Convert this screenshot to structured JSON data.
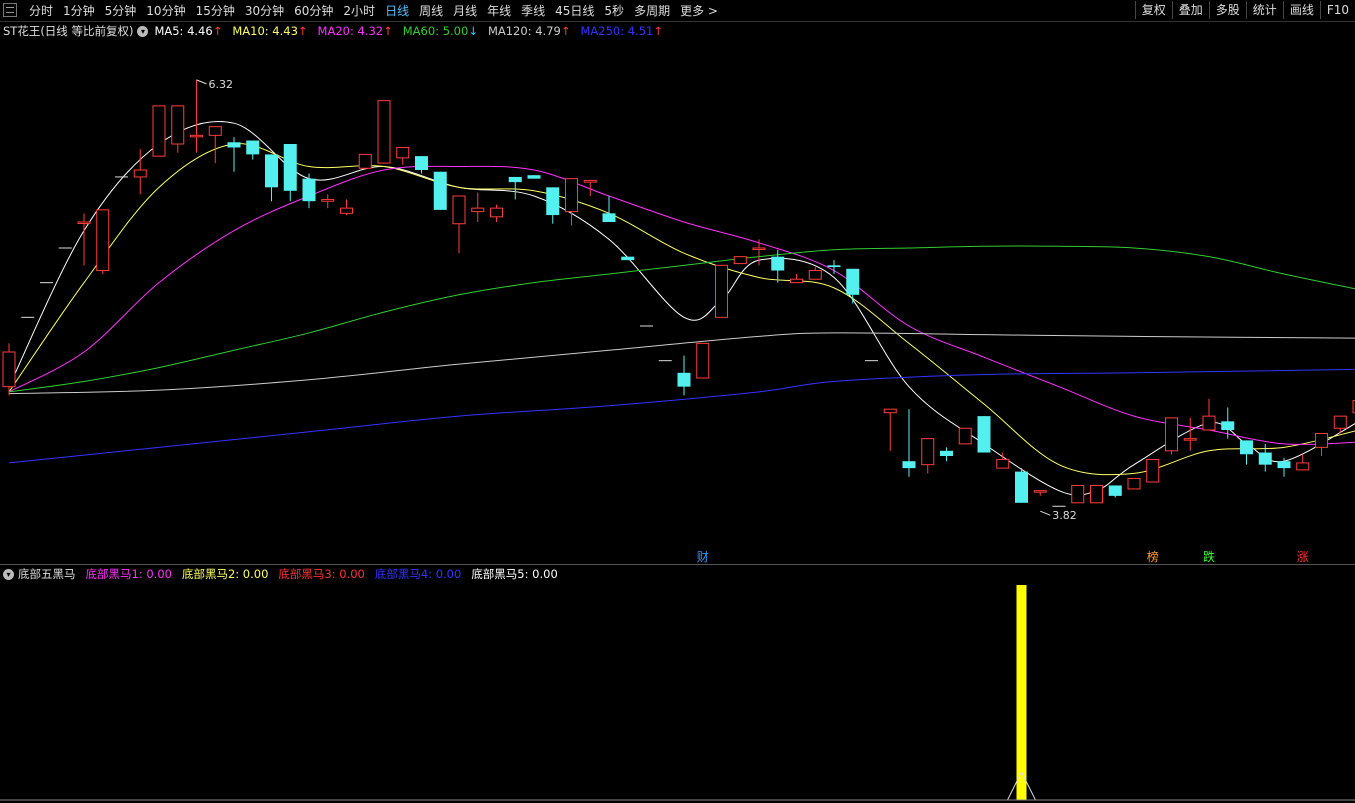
{
  "toolbar": {
    "periods": [
      "分时",
      "1分钟",
      "5分钟",
      "10分钟",
      "15分钟",
      "30分钟",
      "60分钟",
      "2小时",
      "日线",
      "周线",
      "月线",
      "年线",
      "季线",
      "45日线",
      "5秒",
      "多周期",
      "更多 >"
    ],
    "active_period": "日线",
    "tools": [
      "复权",
      "叠加",
      "多股",
      "统计",
      "画线",
      "F10"
    ]
  },
  "ma_legend": {
    "stock": "ST花王(日线 等比前复权)",
    "items": [
      {
        "label": "MA5: 4.46",
        "arrow": "↑",
        "color": "#ffffff"
      },
      {
        "label": "MA10: 4.43",
        "arrow": "↑",
        "color": "#ffff66"
      },
      {
        "label": "MA20: 4.32",
        "arrow": "↑",
        "color": "#ff33ff"
      },
      {
        "label": "MA60: 5.00",
        "arrow": "↓",
        "color": "#33cc33"
      },
      {
        "label": "MA120: 4.79",
        "arrow": "↑",
        "color": "#cccccc"
      },
      {
        "label": "MA250: 4.51",
        "arrow": "↑",
        "color": "#3333ff"
      }
    ]
  },
  "annotations": {
    "high_label": "6.32",
    "low_label": "3.82",
    "markers": [
      {
        "text": "财",
        "color": "#3399ff",
        "index": 37
      },
      {
        "text": "榜",
        "color": "#ff9933",
        "index": 61
      },
      {
        "text": "跌",
        "color": "#33ff33",
        "index": 64
      },
      {
        "text": "涨",
        "color": "#ff3333",
        "index": 69
      }
    ]
  },
  "indicator_legend": {
    "name": "底部五黑马",
    "items": [
      {
        "label": "底部黑马1: 0.00",
        "color": "#ff33ff"
      },
      {
        "label": "底部黑马2: 0.00",
        "color": "#ffff66"
      },
      {
        "label": "底部黑马3: 0.00",
        "color": "#ff3333"
      },
      {
        "label": "底部黑马4: 0.00",
        "color": "#3333ff"
      },
      {
        "label": "底部黑马5: 0.00",
        "color": "#ffffff"
      }
    ],
    "signal_index": 54,
    "signal_value": 1
  },
  "colors": {
    "up": "#ff3c3c",
    "down": "#54f0f0",
    "bg": "#000000"
  },
  "chart_data": {
    "type": "candlestick",
    "price_range": [
      3.55,
      6.55
    ],
    "candles": [
      [
        4.55,
        4.75,
        4.5,
        4.8
      ],
      [
        4.95,
        4.95,
        4.95,
        4.95
      ],
      [
        5.15,
        5.15,
        5.15,
        5.15
      ],
      [
        5.35,
        5.35,
        5.35,
        5.35
      ],
      [
        5.5,
        5.5,
        5.25,
        5.55
      ],
      [
        5.22,
        5.57,
        5.2,
        5.57
      ],
      [
        5.76,
        5.76,
        5.76,
        5.76
      ],
      [
        5.76,
        5.8,
        5.66,
        5.92
      ],
      [
        5.88,
        6.17,
        6.17,
        6.17
      ],
      [
        5.95,
        6.17,
        5.9,
        6.17
      ],
      [
        6.0,
        6.0,
        5.9,
        6.32
      ],
      [
        6.0,
        6.05,
        5.84,
        6.05
      ],
      [
        5.96,
        5.93,
        5.79,
        5.99
      ],
      [
        5.97,
        5.89,
        5.86,
        5.97
      ],
      [
        5.89,
        5.7,
        5.62,
        5.89
      ],
      [
        5.95,
        5.68,
        5.62,
        5.95
      ],
      [
        5.75,
        5.62,
        5.58,
        5.78
      ],
      [
        5.62,
        5.63,
        5.58,
        5.66
      ],
      [
        5.55,
        5.58,
        5.54,
        5.63
      ],
      [
        5.81,
        5.89,
        5.8,
        5.89
      ],
      [
        5.84,
        6.2,
        6.2,
        6.2
      ],
      [
        5.87,
        5.93,
        5.83,
        5.93
      ],
      [
        5.88,
        5.8,
        5.78,
        5.88
      ],
      [
        5.79,
        5.57,
        5.57,
        5.79
      ],
      [
        5.49,
        5.65,
        5.32,
        5.65
      ],
      [
        5.56,
        5.58,
        5.5,
        5.67
      ],
      [
        5.53,
        5.58,
        5.5,
        5.6
      ],
      [
        5.76,
        5.73,
        5.63,
        5.76
      ],
      [
        5.77,
        5.75,
        5.75,
        5.77
      ],
      [
        5.7,
        5.54,
        5.49,
        5.7
      ],
      [
        5.56,
        5.75,
        5.48,
        5.75
      ],
      [
        5.73,
        5.74,
        5.65,
        5.74
      ],
      [
        5.55,
        5.5,
        5.5,
        5.65
      ],
      [
        5.3,
        5.28,
        5.28,
        5.3
      ],
      [
        4.9,
        4.9,
        4.9,
        4.9
      ],
      [
        4.7,
        4.7,
        4.7,
        4.7
      ],
      [
        4.63,
        4.55,
        4.5,
        4.73
      ],
      [
        4.6,
        4.8,
        4.6,
        4.8
      ],
      [
        4.95,
        5.25,
        4.95,
        5.25
      ],
      [
        5.26,
        5.3,
        5.26,
        5.3
      ],
      [
        5.35,
        5.35,
        5.25,
        5.4
      ],
      [
        5.3,
        5.22,
        5.15,
        5.34
      ],
      [
        5.15,
        5.17,
        5.15,
        5.2
      ],
      [
        5.17,
        5.22,
        5.17,
        5.24
      ],
      [
        5.25,
        5.24,
        5.2,
        5.28
      ],
      [
        5.23,
        5.08,
        5.03,
        5.23
      ],
      [
        4.7,
        4.7,
        4.7,
        4.7
      ],
      [
        4.4,
        4.42,
        4.18,
        4.42
      ],
      [
        4.12,
        4.08,
        4.03,
        4.42
      ],
      [
        4.1,
        4.25,
        4.05,
        4.25
      ],
      [
        4.18,
        4.15,
        4.12,
        4.2
      ],
      [
        4.22,
        4.31,
        4.22,
        4.31
      ],
      [
        4.38,
        4.17,
        4.17,
        4.38
      ],
      [
        4.08,
        4.13,
        4.08,
        4.17
      ],
      [
        4.06,
        3.88,
        3.88,
        4.08
      ],
      [
        3.95,
        3.95,
        3.92,
        3.95
      ],
      [
        3.86,
        3.86,
        3.86,
        3.86
      ],
      [
        3.88,
        3.98,
        3.88,
        3.98
      ],
      [
        3.88,
        3.98,
        3.88,
        3.98
      ],
      [
        3.98,
        3.92,
        3.91,
        3.98
      ],
      [
        3.96,
        4.02,
        3.96,
        4.02
      ],
      [
        4.0,
        4.13,
        4.0,
        4.13
      ],
      [
        4.18,
        4.37,
        4.16,
        4.37
      ],
      [
        4.25,
        4.25,
        4.18,
        4.37
      ],
      [
        4.3,
        4.38,
        4.3,
        4.48
      ],
      [
        4.35,
        4.3,
        4.25,
        4.43
      ],
      [
        4.24,
        4.16,
        4.1,
        4.24
      ],
      [
        4.17,
        4.1,
        4.06,
        4.22
      ],
      [
        4.12,
        4.08,
        4.03,
        4.14
      ],
      [
        4.07,
        4.11,
        4.07,
        4.16
      ],
      [
        4.2,
        4.28,
        4.15,
        4.28
      ],
      [
        4.31,
        4.38,
        4.28,
        4.38
      ],
      [
        4.4,
        4.47,
        4.4,
        4.47
      ]
    ],
    "ma_lines": [
      {
        "name": "MA5",
        "color": "#ffffff",
        "values": [
          [
            0,
            4.55
          ],
          [
            4,
            5.45
          ],
          [
            8,
            5.95
          ],
          [
            12,
            6.07
          ],
          [
            16,
            5.75
          ],
          [
            20,
            5.82
          ],
          [
            24,
            5.7
          ],
          [
            28,
            5.65
          ],
          [
            32,
            5.4
          ],
          [
            36,
            4.95
          ],
          [
            38,
            5.05
          ],
          [
            40,
            5.28
          ],
          [
            44,
            5.18
          ],
          [
            48,
            4.55
          ],
          [
            52,
            4.22
          ],
          [
            56,
            3.95
          ],
          [
            58,
            3.95
          ],
          [
            60,
            4.1
          ],
          [
            64,
            4.34
          ],
          [
            66,
            4.22
          ],
          [
            68,
            4.12
          ],
          [
            72,
            4.35
          ]
        ]
      },
      {
        "name": "MA10",
        "color": "#ffff66",
        "values": [
          [
            0,
            4.52
          ],
          [
            4,
            5.15
          ],
          [
            8,
            5.7
          ],
          [
            12,
            5.95
          ],
          [
            16,
            5.82
          ],
          [
            20,
            5.82
          ],
          [
            24,
            5.7
          ],
          [
            28,
            5.68
          ],
          [
            32,
            5.55
          ],
          [
            36,
            5.32
          ],
          [
            40,
            5.18
          ],
          [
            44,
            5.12
          ],
          [
            48,
            4.8
          ],
          [
            52,
            4.45
          ],
          [
            56,
            4.1
          ],
          [
            60,
            4.05
          ],
          [
            64,
            4.18
          ],
          [
            68,
            4.2
          ],
          [
            72,
            4.3
          ]
        ]
      },
      {
        "name": "MA20",
        "color": "#ff33ff",
        "values": [
          [
            0,
            4.52
          ],
          [
            4,
            4.75
          ],
          [
            8,
            5.15
          ],
          [
            12,
            5.45
          ],
          [
            16,
            5.65
          ],
          [
            20,
            5.8
          ],
          [
            24,
            5.82
          ],
          [
            28,
            5.8
          ],
          [
            32,
            5.65
          ],
          [
            36,
            5.5
          ],
          [
            40,
            5.38
          ],
          [
            44,
            5.22
          ],
          [
            48,
            4.9
          ],
          [
            52,
            4.72
          ],
          [
            56,
            4.55
          ],
          [
            60,
            4.38
          ],
          [
            64,
            4.3
          ],
          [
            68,
            4.22
          ],
          [
            72,
            4.23
          ]
        ]
      },
      {
        "name": "MA60",
        "color": "#33cc33",
        "values": [
          [
            0,
            4.52
          ],
          [
            4,
            4.58
          ],
          [
            8,
            4.66
          ],
          [
            12,
            4.76
          ],
          [
            16,
            4.86
          ],
          [
            20,
            4.98
          ],
          [
            24,
            5.08
          ],
          [
            28,
            5.15
          ],
          [
            32,
            5.2
          ],
          [
            36,
            5.25
          ],
          [
            40,
            5.3
          ],
          [
            44,
            5.34
          ],
          [
            48,
            5.35
          ],
          [
            52,
            5.36
          ],
          [
            56,
            5.36
          ],
          [
            60,
            5.35
          ],
          [
            64,
            5.3
          ],
          [
            68,
            5.2
          ],
          [
            72,
            5.11
          ]
        ]
      },
      {
        "name": "MA120",
        "color": "#cccccc",
        "values": [
          [
            0,
            4.51
          ],
          [
            8,
            4.53
          ],
          [
            16,
            4.59
          ],
          [
            24,
            4.68
          ],
          [
            32,
            4.76
          ],
          [
            40,
            4.84
          ],
          [
            44,
            4.86
          ],
          [
            52,
            4.85
          ],
          [
            60,
            4.84
          ],
          [
            72,
            4.83
          ]
        ]
      },
      {
        "name": "MA250",
        "color": "#3333ff",
        "values": [
          [
            0,
            4.11
          ],
          [
            8,
            4.2
          ],
          [
            16,
            4.29
          ],
          [
            24,
            4.38
          ],
          [
            32,
            4.44
          ],
          [
            40,
            4.52
          ],
          [
            44,
            4.58
          ],
          [
            52,
            4.62
          ],
          [
            60,
            4.63
          ],
          [
            72,
            4.65
          ]
        ]
      }
    ]
  }
}
